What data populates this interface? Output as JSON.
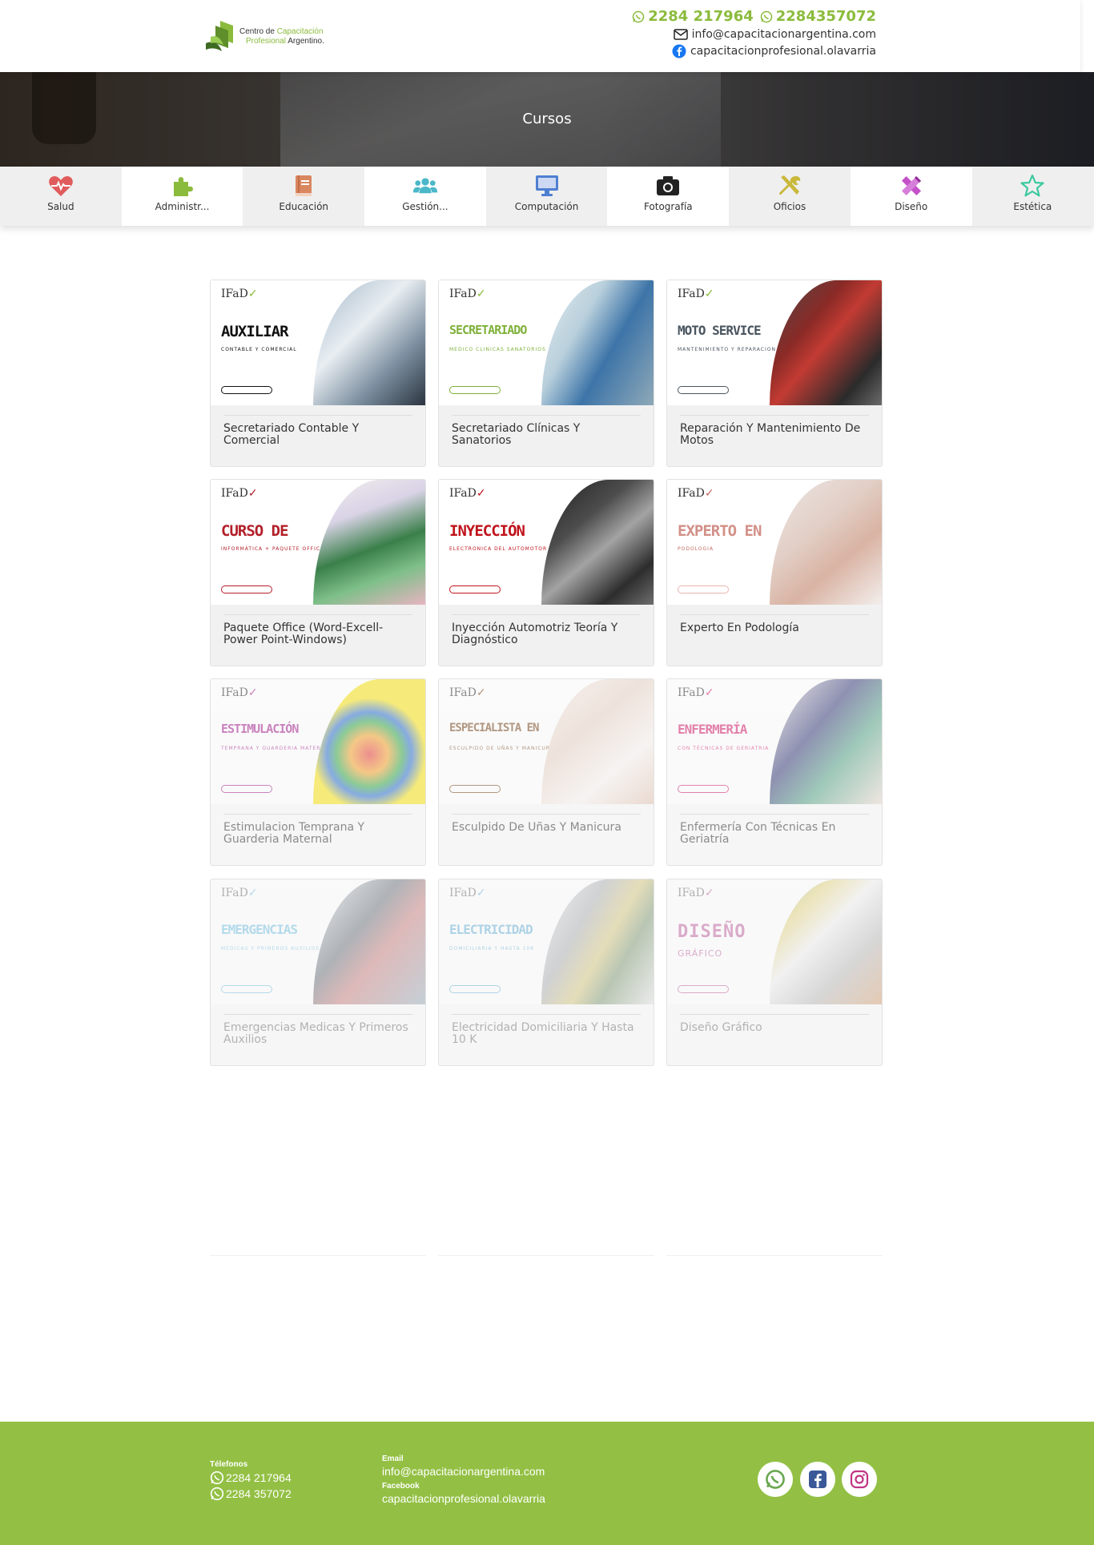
{
  "brand": {
    "logo_line1": "Centro de",
    "logo_line1_green": "Capacitación",
    "logo_line2_green": "Profesional",
    "logo_line2": "Argentino.",
    "accent": "#8bbb3c"
  },
  "header": {
    "phone1": "2284 217964",
    "phone2": "2284357072",
    "email": "info@capacitacionargentina.com",
    "facebook": "capacitacionprofesional.olavarria"
  },
  "hero": {
    "title": "Cursos"
  },
  "categories": [
    {
      "label": "Salud",
      "icon": "heartbeat-icon",
      "color": "#e05c5c"
    },
    {
      "label": "Administr...",
      "icon": "puzzle-icon",
      "color": "#8bbb3c"
    },
    {
      "label": "Educación",
      "icon": "book-icon",
      "color": "#d9875f"
    },
    {
      "label": "Gestión...",
      "icon": "users-icon",
      "color": "#4ab8c8"
    },
    {
      "label": "Computación",
      "icon": "desktop-icon",
      "color": "#4f7fd1"
    },
    {
      "label": "Fotografía",
      "icon": "camera-icon",
      "color": "#222222"
    },
    {
      "label": "Oficios",
      "icon": "tools-icon",
      "color": "#c9b83a"
    },
    {
      "label": "Diseño",
      "icon": "pencil-ruler-icon",
      "color": "#c451c8"
    },
    {
      "label": "Estética",
      "icon": "star-icon",
      "color": "#3cc9a0"
    }
  ],
  "courses": [
    {
      "label": "Secretariado Contable Y Comercial",
      "img_title": "AUXILIAR",
      "img_sub": "CONTABLE Y COMERCIAL",
      "color": "#111111"
    },
    {
      "label": "Secretariado Clínicas Y Sanatorios",
      "img_title": "SECRETARIADO",
      "img_sub": "MEDICO CLINICAS SANATORIOS",
      "color": "#7fb13a"
    },
    {
      "label": "Reparación Y Mantenimiento De Motos",
      "img_title": "MOTO SERVICE",
      "img_sub": "MANTENIMIENTO Y REPARACION DE MOTOS",
      "color": "#4a5560"
    },
    {
      "label": "Paquete Office (Word-Excell-Power Point-Windows)",
      "img_title": "CURSO DE",
      "img_sub": "INFORMÁTICA + PAQUETE OFFICE",
      "color": "#b3202a"
    },
    {
      "label": "Inyección Automotriz Teoría Y Diagnóstico",
      "img_title": "INYECCIÓN",
      "img_sub": "ELECTRONICA DEL AUTOMOTOR",
      "color": "#c0141c"
    },
    {
      "label": "Experto En Podología",
      "img_title": "EXPERTO EN",
      "img_sub": "PODOLOGIA",
      "color": "#c46b60"
    },
    {
      "label": "Estimulacion Temprana Y Guarderia Maternal",
      "img_title": "ESTIMULACIÓN",
      "img_sub": "TEMPRANA Y GUARDERIA MATERNAL",
      "color": "#a5258f"
    },
    {
      "label": "Esculpido De Uñas Y Manicura",
      "img_title": "ESPECIALISTA EN",
      "img_sub": "ESCULPIDO DE UÑAS Y MANICURA",
      "color": "#7a4a22"
    },
    {
      "label": "Enfermería Con Técnicas En Geriatría",
      "img_title": "ENFERMERÍA",
      "img_sub": "CON TÉCNICAS DE GERIATRIA",
      "color": "#d2236e"
    },
    {
      "label": "Emergencias Medicas Y Primeros Auxilios",
      "img_title": "EMERGENCIAS",
      "img_sub": "MÉDICAS Y PRIMEROS AUXILIOS",
      "color": "#3aa8d8"
    },
    {
      "label": "Electricidad Domiciliaria Y Hasta 10 K",
      "img_title": "ELECTRICIDAD",
      "img_sub": "DOMICILIARIA Y HASTA 10K",
      "color": "#2c94c9"
    },
    {
      "label": "Diseño Gráfico",
      "img_title": "DISEÑO",
      "img_sub": "GRÁFICO",
      "color": "#a8227a"
    }
  ],
  "footer": {
    "phones_label": "Télefonos",
    "phone1": "2284 217964",
    "phone2": "2284 357072",
    "email_label": "Email",
    "email": "info@capacitacionargentina.com",
    "facebook_label": "Facebook",
    "facebook": "capacitacionprofesional.olavarria",
    "social": [
      "whatsapp-icon",
      "facebook-icon",
      "instagram-icon"
    ]
  }
}
